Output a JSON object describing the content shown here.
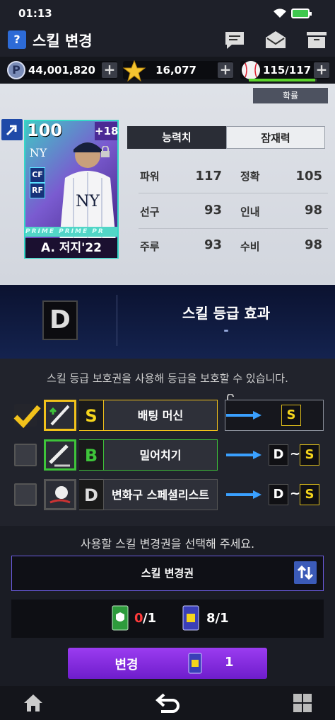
{
  "status": {
    "time": "01:13"
  },
  "header": {
    "help": "?",
    "title": "스킬 변경"
  },
  "currency": {
    "points": "44,001,820",
    "stars": "16,077",
    "stamina": "115/117",
    "stamina_fill": 0.98,
    "points_icon": "P"
  },
  "player": {
    "expand_label": "확률",
    "ovr": "100",
    "plus": "+18",
    "positions": [
      "CF",
      "RF"
    ],
    "card_band": "PRIME  PRIME  PR",
    "name": "A. 저지'22",
    "tabs": {
      "active": "능력치",
      "other": "잠재력"
    },
    "stats": [
      {
        "label": "파워",
        "value": "117"
      },
      {
        "label": "정확",
        "value": "105"
      },
      {
        "label": "선구",
        "value": "93"
      },
      {
        "label": "인내",
        "value": "98"
      },
      {
        "label": "주루",
        "value": "93"
      },
      {
        "label": "수비",
        "value": "98"
      }
    ]
  },
  "grade": {
    "letter": "D",
    "title": "스킬 등급 효과",
    "value": "-"
  },
  "skills": {
    "info": "스킬 등급 보호권을 사용해 등급을 보호할 수 있습니다.",
    "rows": [
      {
        "grade": "S",
        "name": "배팅 머신",
        "checked": true,
        "result": [
          "S"
        ]
      },
      {
        "grade": "B",
        "name": "밀어치기",
        "checked": false,
        "result": [
          "D",
          "~",
          "S"
        ]
      },
      {
        "grade": "D",
        "name": "변화구 스페셜리스트",
        "checked": false,
        "result": [
          "D",
          "~",
          "S"
        ]
      }
    ]
  },
  "ticket": {
    "prompt": "사용할 스킬 변경권을 선택해 주세요.",
    "select_label": "스킬 변경권",
    "protect_count": "0",
    "protect_total": "/1",
    "change_count": "8/1"
  },
  "action": {
    "label": "변경",
    "count": "1"
  },
  "colors": {
    "accent": "#7d2be0",
    "grade_s": "#f5d51c",
    "grade_b": "#3ec43a",
    "check": "#f2c21b"
  }
}
